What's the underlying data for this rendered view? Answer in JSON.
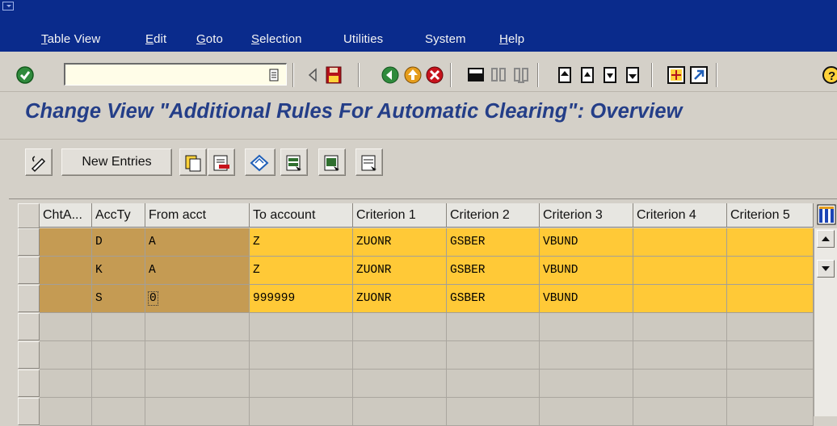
{
  "menubar": {
    "items": [
      {
        "accel": "T",
        "rest": "able View"
      },
      {
        "accel": "E",
        "rest": "dit"
      },
      {
        "accel": "G",
        "rest": "oto"
      },
      {
        "accel": "S",
        "rest": "election"
      },
      {
        "accel": "",
        "rest": "Utilities"
      },
      {
        "accel": "",
        "rest": "System"
      },
      {
        "accel": "H",
        "rest": "elp"
      }
    ]
  },
  "standard_toolbar": {
    "command_field_value": "",
    "icons": [
      "enter-icon",
      "save-icon",
      "back-icon",
      "exit-icon",
      "cancel-icon",
      "print-icon",
      "find-icon",
      "find-next-icon",
      "first-page-icon",
      "previous-page-icon",
      "next-page-icon",
      "last-page-icon",
      "create-session-icon",
      "shortcut-icon",
      "help-icon"
    ]
  },
  "title": "Change View \"Additional Rules For Automatic Clearing\": Overview",
  "app_toolbar": {
    "new_entries_label": "New Entries",
    "icons": [
      "display-change-icon",
      "copy-icon",
      "delete-icon",
      "undo-change-icon",
      "select-all-icon",
      "select-block-icon",
      "deselect-all-icon"
    ]
  },
  "table": {
    "columns": [
      "ChtA...",
      "AccTy",
      "From acct",
      "To account",
      "Criterion 1",
      "Criterion 2",
      "Criterion 3",
      "Criterion 4",
      "Criterion 5"
    ],
    "rows": [
      [
        "",
        "D",
        "A",
        "Z",
        "ZUONR",
        "GSBER",
        "VBUND",
        "",
        ""
      ],
      [
        "",
        "K",
        "A",
        "Z",
        "ZUONR",
        "GSBER",
        "VBUND",
        "",
        ""
      ],
      [
        "",
        "S",
        "0",
        "999999",
        "ZUONR",
        "GSBER",
        "VBUND",
        "",
        ""
      ]
    ],
    "empty_row_count": 4
  },
  "colors": {
    "menubar_bg": "#0a2b8c",
    "title_color": "#243e88",
    "key_cell_bg": "#c59b53",
    "data_cell_bg": "#ffc937",
    "empty_cell_bg": "#cdc9c0"
  }
}
